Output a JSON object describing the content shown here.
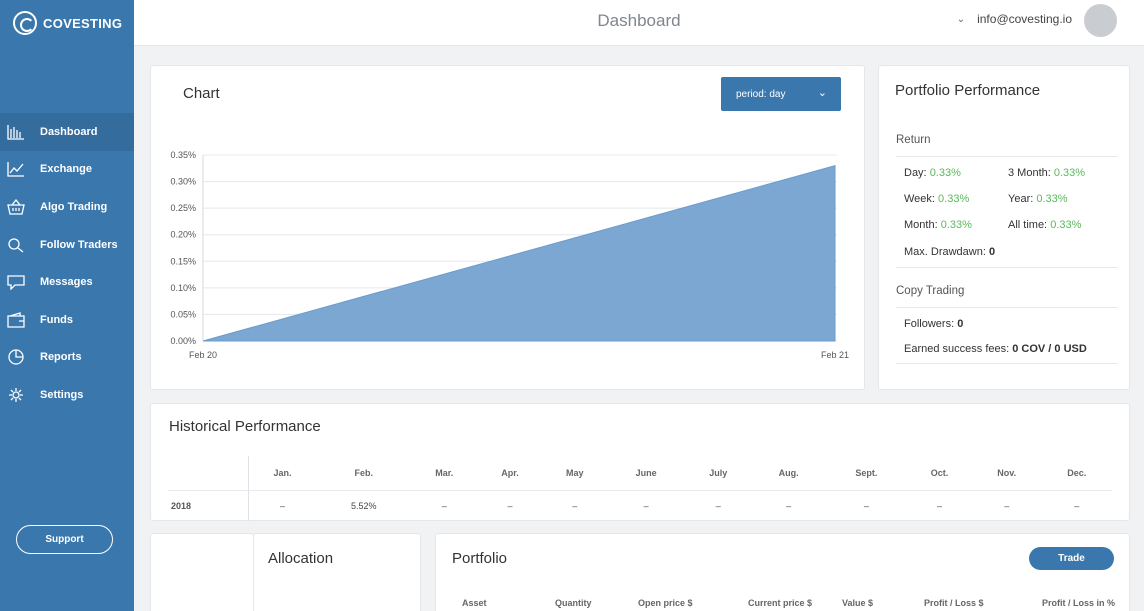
{
  "app": {
    "brand": "COVESTING"
  },
  "header": {
    "title": "Dashboard",
    "email": "info@covesting.io"
  },
  "sidebar": {
    "items": [
      {
        "label": "Dashboard",
        "icon": "bar-chart-icon"
      },
      {
        "label": "Exchange",
        "icon": "line-chart-icon"
      },
      {
        "label": "Algo Trading",
        "icon": "basket-icon"
      },
      {
        "label": "Follow Traders",
        "icon": "search-icon"
      },
      {
        "label": "Messages",
        "icon": "chat-icon"
      },
      {
        "label": "Funds",
        "icon": "wallet-icon"
      },
      {
        "label": "Reports",
        "icon": "pie-chart-icon"
      },
      {
        "label": "Settings",
        "icon": "gear-icon"
      }
    ],
    "support_label": "Support"
  },
  "chart_card": {
    "title": "Chart",
    "period_label": "period: day"
  },
  "chart_data": {
    "type": "area",
    "x": [
      "Feb 20",
      "Feb 21"
    ],
    "values": [
      0.0,
      0.33
    ],
    "yticks": [
      "0.35%",
      "0.30%",
      "0.25%",
      "0.20%",
      "0.15%",
      "0.10%",
      "0.05%",
      "0.00%"
    ],
    "ylim": [
      0,
      0.35
    ],
    "grid": true,
    "color": "#7ba7d2"
  },
  "performance": {
    "title": "Portfolio Performance",
    "return_label": "Return",
    "day_label": "Day:",
    "day_value": "0.33%",
    "three_month_label": "3 Month:",
    "three_month_value": "0.33%",
    "week_label": "Week:",
    "week_value": "0.33%",
    "year_label": "Year:",
    "year_value": "0.33%",
    "month_label": "Month:",
    "month_value": "0.33%",
    "all_time_label": "All time:",
    "all_time_value": "0.33%",
    "drawdown_label": "Max. Drawdawn:",
    "drawdown_value": "0",
    "copy_label": "Copy Trading",
    "followers_label": "Followers:",
    "followers_value": "0",
    "fees_label": "Earned success fees:",
    "fees_value": "0 COV / 0 USD"
  },
  "historical": {
    "title": "Historical Performance",
    "months": [
      "Jan.",
      "Feb.",
      "Mar.",
      "Apr.",
      "May",
      "June",
      "July",
      "Aug.",
      "Sept.",
      "Oct.",
      "Nov.",
      "Dec."
    ],
    "row": {
      "year": "2018",
      "values": [
        "–",
        "5.52%",
        "–",
        "–",
        "–",
        "–",
        "–",
        "–",
        "–",
        "–",
        "–",
        "–"
      ]
    }
  },
  "allocation": {
    "title": "Allocation"
  },
  "portfolio": {
    "title": "Portfolio",
    "trade_label": "Trade",
    "columns": [
      "Asset",
      "Quantity",
      "Open price $",
      "Current price $",
      "Value $",
      "Profit / Loss $",
      "Profit / Loss in %"
    ]
  },
  "colors": {
    "accent": "#3a77ad",
    "positive": "#5cb85c"
  }
}
